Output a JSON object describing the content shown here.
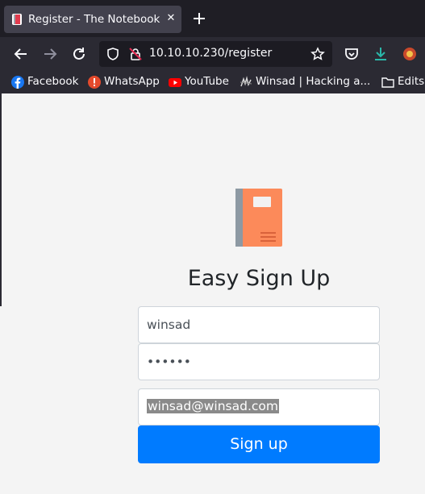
{
  "browser": {
    "tab": {
      "title": "Register - The Notebook",
      "close_icon": "close-icon"
    },
    "new_tab_icon": "plus-icon",
    "url": "10.10.10.230/register",
    "bookmarks": [
      {
        "label": "Facebook",
        "icon": "facebook-icon"
      },
      {
        "label": "WhatsApp",
        "icon": "whatsapp-icon"
      },
      {
        "label": "YouTube",
        "icon": "youtube-icon"
      },
      {
        "label": "Winsad | Hacking a...",
        "icon": "winsad-icon"
      },
      {
        "label": "Edits",
        "icon": "folder-icon"
      }
    ]
  },
  "page": {
    "heading": "Easy Sign Up",
    "username_value": "winsad",
    "password_value": "••••••",
    "email_value": "winsad@winsad.com",
    "signup_label": "Sign up"
  },
  "colors": {
    "primary": "#007bff",
    "book_cover": "#fc8a5a",
    "chrome_dark": "#2b2a33"
  }
}
